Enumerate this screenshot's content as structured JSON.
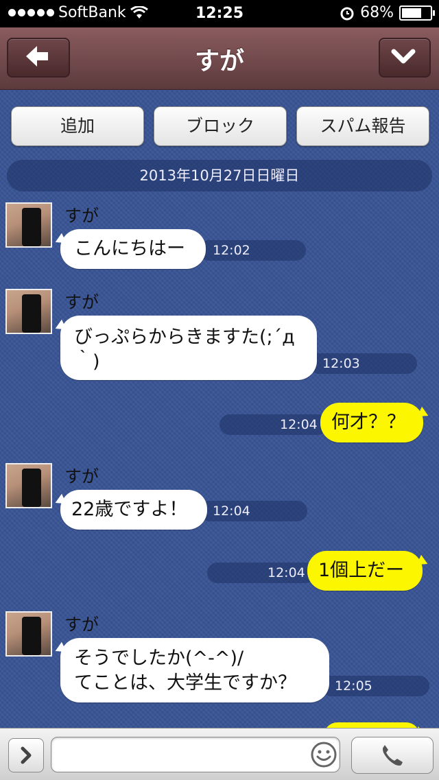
{
  "status_bar": {
    "carrier": "SoftBank",
    "time": "12:25",
    "battery": "68%"
  },
  "nav": {
    "title": "すが"
  },
  "actions": {
    "add": "追加",
    "block": "ブロック",
    "spam": "スパム報告"
  },
  "date_label": "2013年10月27日日曜日",
  "messages": [
    {
      "sender": "すが",
      "text": "こんにちはー",
      "time": "12:02"
    },
    {
      "sender": "すが",
      "text_line1": "びっぷらからきますた(;´д",
      "text_line2": "｀)",
      "time": "12:03"
    },
    {
      "text": "何才？？",
      "time": "12:04"
    },
    {
      "sender": "すが",
      "text": "22歳ですよ！",
      "time": "12:04"
    },
    {
      "text": "1個上だー",
      "time": "12:04"
    },
    {
      "sender": "すが",
      "text_line1": "そうでしたか(^-^)/",
      "text_line2": "てことは、大学生ですか？",
      "time": "12:05"
    }
  ],
  "input": {
    "placeholder": ""
  },
  "colors": {
    "nav": "#6f4548",
    "chat_bg": "#3a5595",
    "outgoing_bubble": "#fcf700",
    "incoming_bubble": "#ffffff"
  }
}
